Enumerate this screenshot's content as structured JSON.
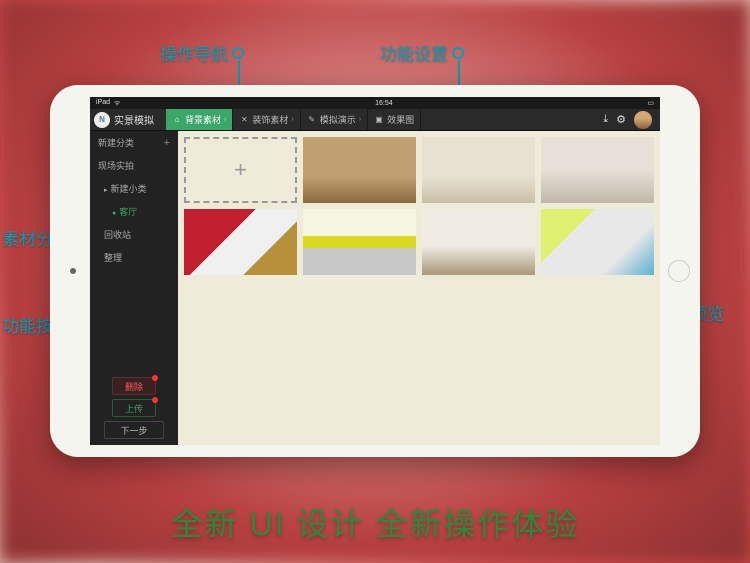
{
  "statusbar": {
    "carrier": "iPad",
    "wifi": "᯾",
    "time": "16:54",
    "battery": "▮"
  },
  "header": {
    "app_title": "实景模拟",
    "logo_letter": "N"
  },
  "tabs": [
    {
      "label": "背景素材",
      "icon": "⌂",
      "active": true
    },
    {
      "label": "装饰素材",
      "icon": "✕",
      "active": false
    },
    {
      "label": "模拟演示",
      "icon": "✎",
      "active": false
    },
    {
      "label": "效果图",
      "icon": "▣",
      "active": false
    }
  ],
  "right_icons": {
    "download": "⤓",
    "settings": "⚙"
  },
  "sidebar": {
    "items": [
      {
        "label": "新建分类",
        "plus": true
      },
      {
        "label": "现场实拍"
      },
      {
        "label": "新建小类",
        "sub": true,
        "tri": true
      },
      {
        "label": "客厅",
        "sub2": true,
        "selected": true,
        "dot": true
      },
      {
        "label": "回收站",
        "sub": true
      },
      {
        "label": "整理",
        "sub": true
      }
    ],
    "buttons": {
      "delete": "删除",
      "upload": "上传",
      "next": "下一步"
    }
  },
  "thumbnails": {
    "add_label": "+"
  },
  "annotations": {
    "nav": "操作导航",
    "settings": "功能设置",
    "category": "素材分类",
    "buttons": "功能按钮",
    "preview": "素材预览"
  },
  "hero": "全新 UI 设计  全新操作体验"
}
